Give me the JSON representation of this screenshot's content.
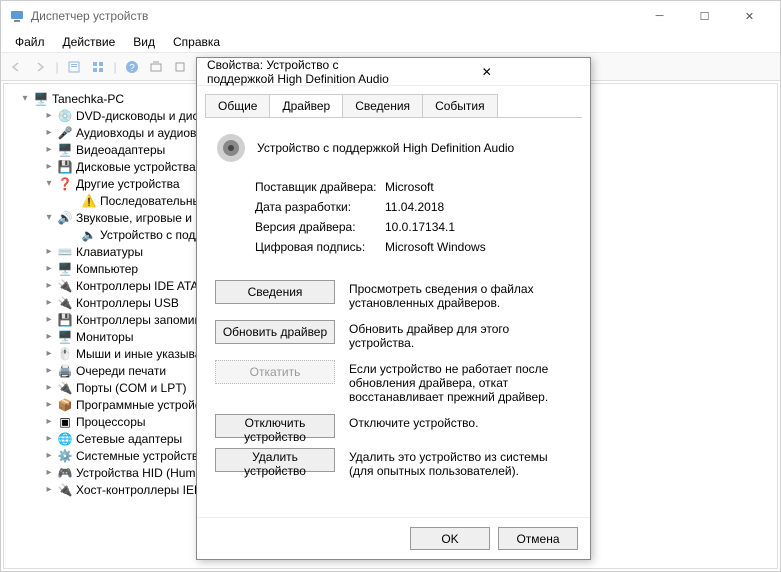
{
  "window": {
    "title": "Диспетчер устройств"
  },
  "menu": {
    "file": "Файл",
    "action": "Действие",
    "view": "Вид",
    "help": "Справка"
  },
  "tree": {
    "root": "Tanechka-PC",
    "items": [
      "DVD-дисководы и диск",
      "Аудиовходы и аудиов",
      "Видеоадаптеры",
      "Дисковые устройства",
      "Другие устройства",
      "Последовательный",
      "Звуковые, игровые и в",
      "Устройство с подде",
      "Клавиатуры",
      "Компьютер",
      "Контроллеры IDE ATA/",
      "Контроллеры USB",
      "Контроллеры запомин",
      "Мониторы",
      "Мыши и иные указыва",
      "Очереди печати",
      "Порты (COM и LPT)",
      "Программные устройс",
      "Процессоры",
      "Сетевые адаптеры",
      "Системные устройства",
      "Устройства HID (Huma",
      "Хост-контроллеры IEE"
    ]
  },
  "dialog": {
    "title": "Свойства: Устройство с поддержкой High Definition Audio",
    "tabs": {
      "general": "Общие",
      "driver": "Драйвер",
      "details": "Сведения",
      "events": "События"
    },
    "device_name": "Устройство с поддержкой High Definition Audio",
    "provider_k": "Поставщик драйвера:",
    "provider_v": "Microsoft",
    "date_k": "Дата разработки:",
    "date_v": "11.04.2018",
    "version_k": "Версия драйвера:",
    "version_v": "10.0.17134.1",
    "signer_k": "Цифровая подпись:",
    "signer_v": "Microsoft Windows",
    "btn_details": "Сведения",
    "desc_details": "Просмотреть сведения о файлах установленных драйверов.",
    "btn_update": "Обновить драйвер",
    "desc_update": "Обновить драйвер для этого устройства.",
    "btn_rollback": "Откатить",
    "desc_rollback": "Если устройство не работает после обновления драйвера, откат восстанавливает прежний драйвер.",
    "btn_disable": "Отключить устройство",
    "desc_disable": "Отключите устройство.",
    "btn_uninstall": "Удалить устройство",
    "desc_uninstall": "Удалить это устройство из системы (для опытных пользователей).",
    "ok": "OK",
    "cancel": "Отмена"
  }
}
